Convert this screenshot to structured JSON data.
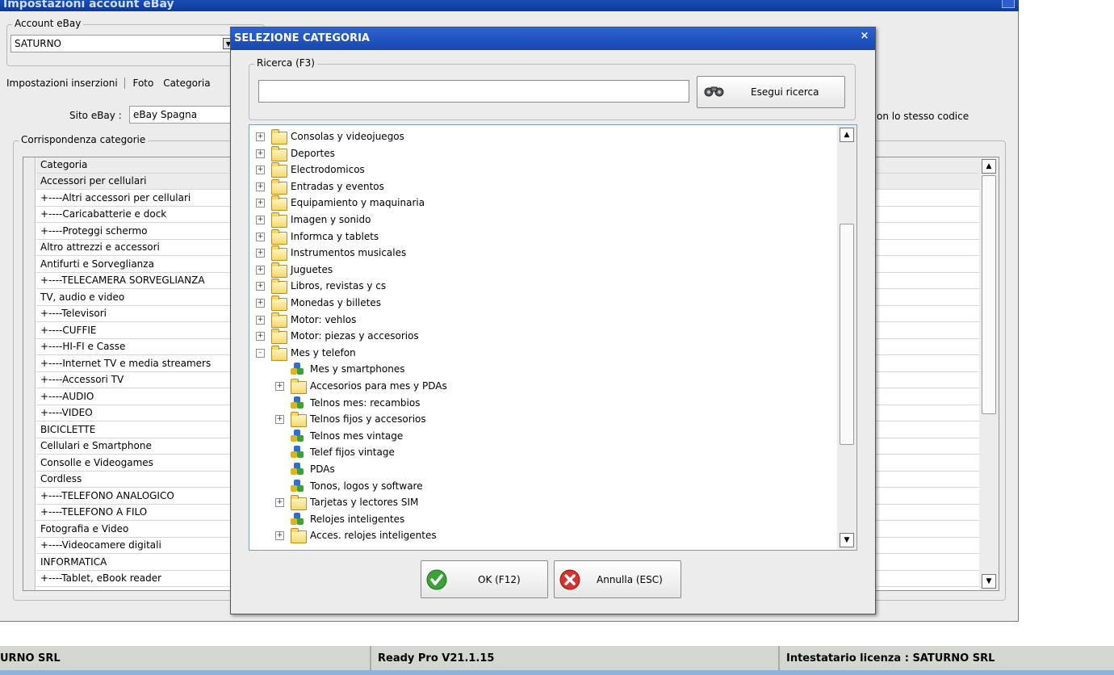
{
  "main_window": {
    "title": "Impostazioni account eBay",
    "account_group": {
      "legend": "Account eBay",
      "selected": "SATURNO"
    },
    "tabs": [
      "Impostazioni inserzioni",
      "Foto",
      "Categoria"
    ],
    "site_label": "Sito eBay :",
    "site_value": "eBay Spagna",
    "same_code_text": "on lo stesso codice",
    "mapping_group": {
      "legend": "Corrispondenza categorie"
    },
    "grid": {
      "header": "Categoria",
      "rows": [
        "Accessori per cellulari",
        "+----Altri accessori per cellulari",
        "+----Caricabatterie e dock",
        "+----Proteggi schermo",
        "Altro attrezzi e accessori",
        "Antifurti e Sorveglianza",
        "+----TELECAMERA SORVEGLIANZA",
        "TV, audio e video",
        "+----Televisori",
        "+----CUFFIE",
        "+----HI-FI e Casse",
        "+----Internet TV e media streamers",
        "+----Accessori TV",
        "+----AUDIO",
        "+----VIDEO",
        "BICICLETTE",
        "Cellulari e Smartphone",
        "Consolle e Videogames",
        "Cordless",
        "+----TELEFONO ANALOGICO",
        "+----TELEFONO A FILO",
        "Fotografia e Video",
        "+----Videocamere digitali",
        "INFORMATICA",
        "+----Tablet, eBook reader"
      ]
    }
  },
  "status_bar": {
    "company": "URNO SRL",
    "version": "Ready Pro V21.1.15",
    "license": "Intestatario licenza : SATURNO SRL"
  },
  "dialog": {
    "title": "SELEZIONE CATEGORIA",
    "search_group": {
      "legend": "Ricerca (F3)",
      "value": ""
    },
    "search_button": "Esegui ricerca",
    "tree": [
      {
        "label": "Consolas y videojuegos",
        "level": 0,
        "kind": "folder",
        "expander": "+"
      },
      {
        "label": "Deportes",
        "level": 0,
        "kind": "folder",
        "expander": "+"
      },
      {
        "label": "Electrodomicos",
        "level": 0,
        "kind": "folder",
        "expander": "+"
      },
      {
        "label": "Entradas y eventos",
        "level": 0,
        "kind": "folder",
        "expander": "+"
      },
      {
        "label": "Equipamiento y maquinaria",
        "level": 0,
        "kind": "folder",
        "expander": "+"
      },
      {
        "label": "Imagen y sonido",
        "level": 0,
        "kind": "folder",
        "expander": "+"
      },
      {
        "label": "Informca y tablets",
        "level": 0,
        "kind": "folder",
        "expander": "+"
      },
      {
        "label": "Instrumentos musicales",
        "level": 0,
        "kind": "folder",
        "expander": "+"
      },
      {
        "label": "Juguetes",
        "level": 0,
        "kind": "folder",
        "expander": "+"
      },
      {
        "label": "Libros, revistas y cs",
        "level": 0,
        "kind": "folder",
        "expander": "+"
      },
      {
        "label": "Monedas y billetes",
        "level": 0,
        "kind": "folder",
        "expander": "+"
      },
      {
        "label": "Motor: vehlos",
        "level": 0,
        "kind": "folder",
        "expander": "+"
      },
      {
        "label": "Motor: piezas y accesorios",
        "level": 0,
        "kind": "folder",
        "expander": "+"
      },
      {
        "label": "Mes y telefon",
        "level": 0,
        "kind": "folder",
        "expander": "-"
      },
      {
        "label": "Mes y smartphones",
        "level": 1,
        "kind": "leaf",
        "expander": ""
      },
      {
        "label": "Accesorios para mes y PDAs",
        "level": 1,
        "kind": "folder",
        "expander": "+"
      },
      {
        "label": "Telnos mes: recambios",
        "level": 1,
        "kind": "leaf",
        "expander": ""
      },
      {
        "label": "Telnos fijos y accesorios",
        "level": 1,
        "kind": "folder",
        "expander": "+"
      },
      {
        "label": "Telnos mes vintage",
        "level": 1,
        "kind": "leaf",
        "expander": ""
      },
      {
        "label": "Telef fijos vintage",
        "level": 1,
        "kind": "leaf",
        "expander": ""
      },
      {
        "label": "PDAs",
        "level": 1,
        "kind": "leaf",
        "expander": ""
      },
      {
        "label": "Tonos, logos y software",
        "level": 1,
        "kind": "leaf",
        "expander": ""
      },
      {
        "label": "Tarjetas y lectores SIM",
        "level": 1,
        "kind": "folder",
        "expander": "+"
      },
      {
        "label": "Relojes inteligentes",
        "level": 1,
        "kind": "leaf",
        "expander": ""
      },
      {
        "label": "Acces. relojes inteligentes",
        "level": 1,
        "kind": "folder",
        "expander": "+"
      }
    ],
    "ok_button": "OK (F12)",
    "cancel_button": "Annulla (ESC)"
  },
  "colors": {
    "title_bar": "#1747b0",
    "grid_highlight": "#ececec",
    "ok_green": "#3aa335",
    "cancel_red": "#d8322c"
  }
}
